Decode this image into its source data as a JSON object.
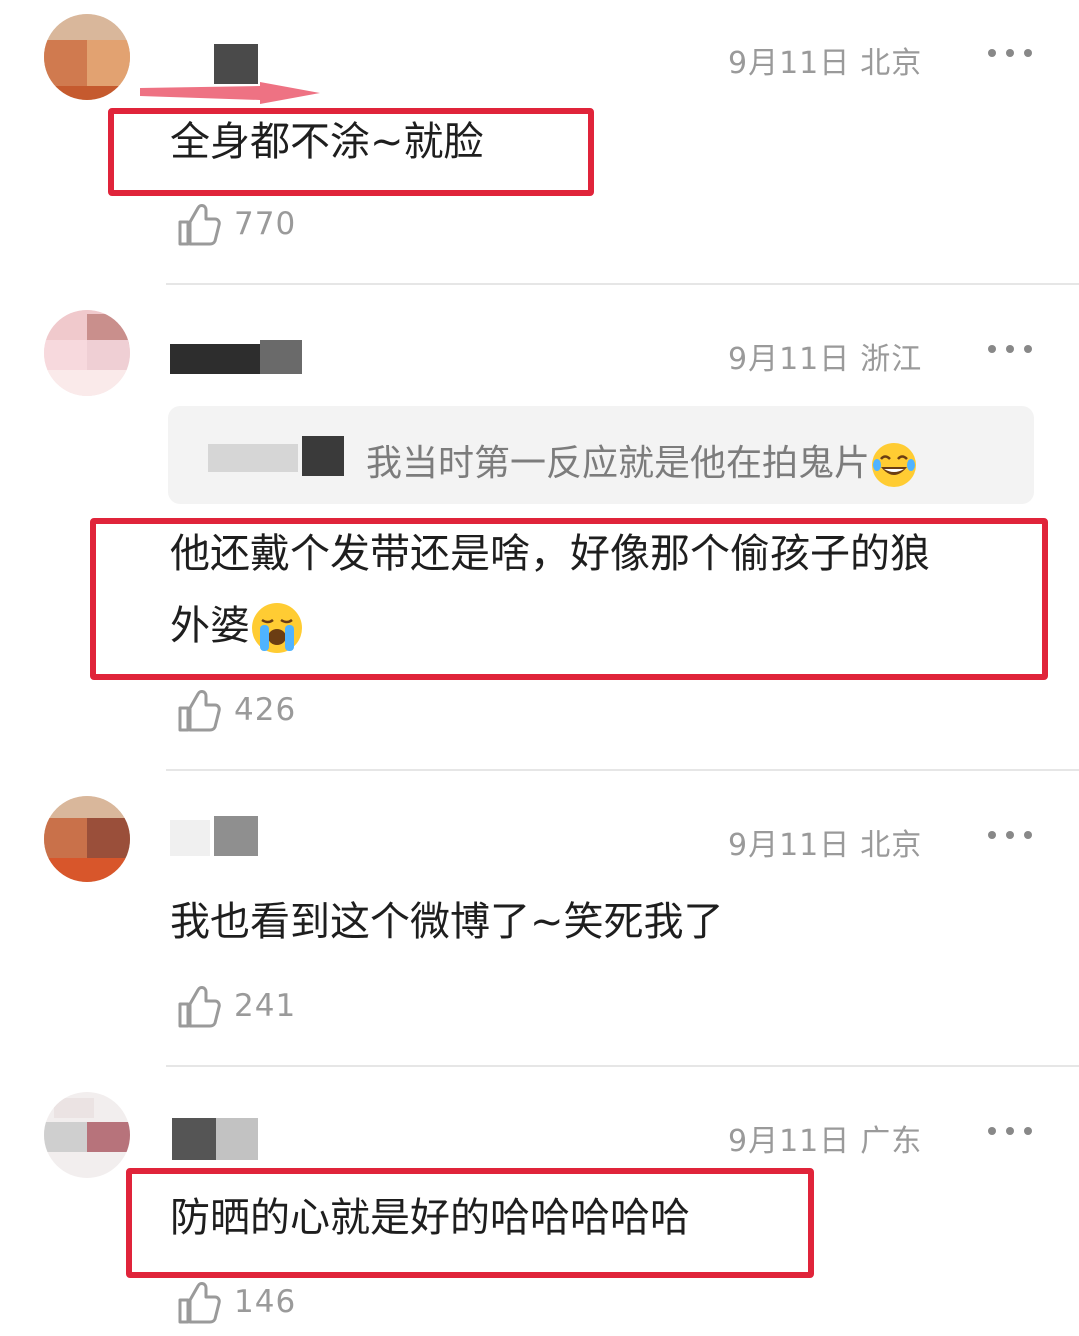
{
  "comments": [
    {
      "date": "9月11日",
      "location": "北京",
      "text": "全身都不涂~就脸",
      "likes": "770"
    },
    {
      "date": "9月11日",
      "location": "浙江",
      "quote": "我当时第一反应就是他在拍鬼片",
      "text_line1": "他还戴个发带还是啥，好像那个偷孩子的狼",
      "text_line2": "外婆",
      "likes": "426"
    },
    {
      "date": "9月11日",
      "location": "北京",
      "text": "我也看到这个微博了~笑死我了",
      "likes": "241"
    },
    {
      "date": "9月11日",
      "location": "广东",
      "text": "防晒的心就是好的哈哈哈哈哈",
      "likes": "146"
    }
  ],
  "icons": {
    "like": "thumbs-up-icon",
    "more": "more-dots-icon",
    "laugh": "laughing-tears-emoji",
    "cry": "loudly-crying-emoji"
  },
  "colors": {
    "highlight_box": "#e0243a",
    "meta_text": "#9a9a9a",
    "body_text": "#1e1e1e"
  }
}
